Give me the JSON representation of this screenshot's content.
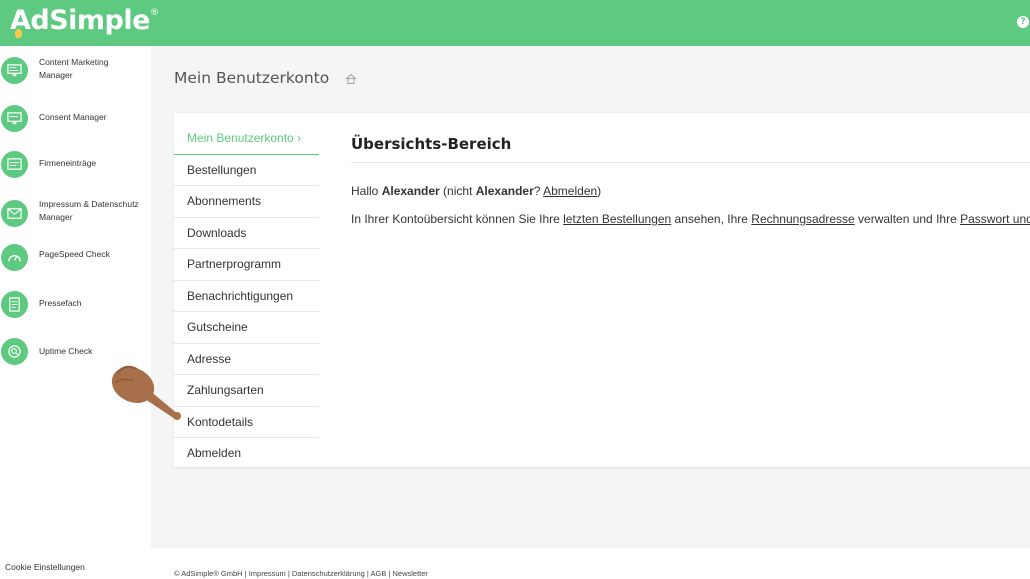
{
  "header": {
    "logo_text": "AdSimple",
    "logo_reg": "®",
    "help_icon": "question-circle-icon",
    "colors": {
      "accent": "#5ec981"
    }
  },
  "sidebar": {
    "items": [
      {
        "label": "Content Marketing Manager",
        "icon": "monitor-icon"
      },
      {
        "label": "Consent Manager",
        "icon": "monitor-icon"
      },
      {
        "label": "Firmeneinträge",
        "icon": "listing-icon"
      },
      {
        "label": "Impressum & Datenschutz Manager",
        "icon": "envelope-icon"
      },
      {
        "label": "PageSpeed Check",
        "icon": "speedometer-icon"
      },
      {
        "label": "Pressefach",
        "icon": "document-icon"
      },
      {
        "label": "Uptime Check",
        "icon": "search-icon"
      }
    ],
    "cookie_label": "Cookie Einstellungen"
  },
  "page": {
    "title": "Mein Benutzerkonto",
    "home_icon": "home-icon"
  },
  "account_menu": {
    "items": [
      "Mein Benutzerkonto ›",
      "Bestellungen",
      "Abonnements",
      "Downloads",
      "Partnerprogramm",
      "Benachrichtigungen",
      "Gutscheine",
      "Adresse",
      "Zahlungsarten",
      "Kontodetails",
      "Abmelden"
    ],
    "active_index": 0
  },
  "overview": {
    "heading": "Übersichts-Bereich",
    "greeting_prefix": "Hallo ",
    "user_name": "Alexander",
    "greeting_middle": " (nicht ",
    "user_name_2": "Alexander",
    "greeting_q": "? ",
    "logout_link": "Abmelden",
    "greeting_suffix": ")",
    "desc_prefix": "In Ihrer Kontoübersicht können Sie Ihre ",
    "link_orders": "letzten Bestellungen",
    "desc_mid1": " ansehen, Ihre ",
    "link_billing": "Rechnungsadresse",
    "desc_mid2": " verwalten und Ihre ",
    "link_password": "Passwort und die"
  },
  "footer": {
    "text": "© AdSimple® GmbH | Impressum | Datenschutzerklärung | AGB | Newsletter"
  }
}
